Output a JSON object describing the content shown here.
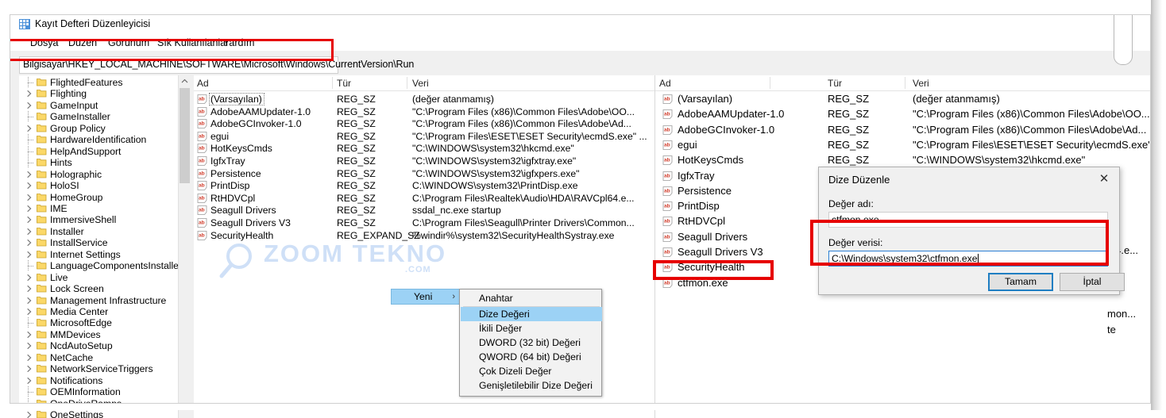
{
  "window": {
    "title": "Kayıt Defteri Düzenleyicisi",
    "icon": "registry-editor-icon",
    "menu": [
      "Dosya",
      "Düzen",
      "Görünüm",
      "Sık Kullanılanlar",
      "Yardım"
    ],
    "address_value": "Bilgisayar\\HKEY_LOCAL_MACHINE\\SOFTWARE\\Microsoft\\Windows\\CurrentVersion\\Run"
  },
  "tree": {
    "items": [
      {
        "label": "FlightedFeatures",
        "expandable": false
      },
      {
        "label": "Flighting",
        "expandable": true
      },
      {
        "label": "GameInput",
        "expandable": true
      },
      {
        "label": "GameInstaller",
        "expandable": false
      },
      {
        "label": "Group Policy",
        "expandable": true
      },
      {
        "label": "HardwareIdentification",
        "expandable": false
      },
      {
        "label": "HelpAndSupport",
        "expandable": false
      },
      {
        "label": "Hints",
        "expandable": false
      },
      {
        "label": "Holographic",
        "expandable": true
      },
      {
        "label": "HoloSI",
        "expandable": true
      },
      {
        "label": "HomeGroup",
        "expandable": true
      },
      {
        "label": "IME",
        "expandable": true
      },
      {
        "label": "ImmersiveShell",
        "expandable": true
      },
      {
        "label": "Installer",
        "expandable": true
      },
      {
        "label": "InstallService",
        "expandable": true
      },
      {
        "label": "Internet Settings",
        "expandable": true
      },
      {
        "label": "LanguageComponentsInstaller",
        "expandable": false
      },
      {
        "label": "Live",
        "expandable": true
      },
      {
        "label": "Lock Screen",
        "expandable": true
      },
      {
        "label": "Management Infrastructure",
        "expandable": true
      },
      {
        "label": "Media Center",
        "expandable": true
      },
      {
        "label": "MicrosoftEdge",
        "expandable": false
      },
      {
        "label": "MMDevices",
        "expandable": true
      },
      {
        "label": "NcdAutoSetup",
        "expandable": true
      },
      {
        "label": "NetCache",
        "expandable": true
      },
      {
        "label": "NetworkServiceTriggers",
        "expandable": true
      },
      {
        "label": "Notifications",
        "expandable": true
      },
      {
        "label": "OEMInformation",
        "expandable": false
      },
      {
        "label": "OneDriveRamps",
        "expandable": false
      },
      {
        "label": "OneSettings",
        "expandable": true
      }
    ]
  },
  "list": {
    "columns": [
      "Ad",
      "Tür",
      "Veri"
    ],
    "rows": [
      {
        "name": "(Varsayılan)",
        "type": "REG_SZ",
        "data": "(değer atanmamış)"
      },
      {
        "name": "AdobeAAMUpdater-1.0",
        "type": "REG_SZ",
        "data": "\"C:\\Program Files (x86)\\Common Files\\Adobe\\OO..."
      },
      {
        "name": "AdobeGCInvoker-1.0",
        "type": "REG_SZ",
        "data": "\"C:\\Program Files (x86)\\Common Files\\Adobe\\Ad..."
      },
      {
        "name": "egui",
        "type": "REG_SZ",
        "data": "\"C:\\Program Files\\ESET\\ESET Security\\ecmdS.exe\" ..."
      },
      {
        "name": "HotKeysCmds",
        "type": "REG_SZ",
        "data": "\"C:\\WINDOWS\\system32\\hkcmd.exe\""
      },
      {
        "name": "IgfxTray",
        "type": "REG_SZ",
        "data": "\"C:\\WINDOWS\\system32\\igfxtray.exe\""
      },
      {
        "name": "Persistence",
        "type": "REG_SZ",
        "data": "\"C:\\WINDOWS\\system32\\igfxpers.exe\""
      },
      {
        "name": "PrintDisp",
        "type": "REG_SZ",
        "data": "C:\\WINDOWS\\system32\\PrintDisp.exe"
      },
      {
        "name": "RtHDVCpl",
        "type": "REG_SZ",
        "data": "C:\\Program Files\\Realtek\\Audio\\HDA\\RAVCpl64.e..."
      },
      {
        "name": "Seagull Drivers",
        "type": "REG_SZ",
        "data": "ssdal_nc.exe startup"
      },
      {
        "name": "Seagull Drivers V3",
        "type": "REG_SZ",
        "data": "C:\\Program Files\\Seagull\\Printer Drivers\\Common..."
      },
      {
        "name": "SecurityHealth",
        "type": "REG_EXPAND_SZ",
        "data": "%windir%\\system32\\SecurityHealthSystray.exe"
      }
    ]
  },
  "right_pane": {
    "columns": [
      "Ad",
      "Tür",
      "Veri"
    ],
    "names": [
      "(Varsayılan)",
      "AdobeAAMUpdater-1.0",
      "AdobeGCInvoker-1.0",
      "egui",
      "HotKeysCmds",
      "IgfxTray",
      "Persistence",
      "PrintDisp",
      "RtHDVCpl",
      "Seagull Drivers",
      "Seagull Drivers V3",
      "SecurityHealth",
      "ctfmon.exe"
    ],
    "types": [
      "REG_SZ",
      "REG_SZ",
      "REG_SZ",
      "REG_SZ",
      "REG_SZ"
    ],
    "datas": [
      "(değer atanmamış)",
      "\"C:\\Program Files (x86)\\Common Files\\Adobe\\OO...",
      "\"C:\\Program Files (x86)\\Common Files\\Adobe\\Ad...",
      "\"C:\\Program Files\\ESET\\ESET Security\\ecmdS.exe\" ...",
      "\"C:\\WINDOWS\\system32\\hkcmd.exe\""
    ],
    "clipped_tails": [
      "l64.e...",
      "mon...",
      "te"
    ]
  },
  "context_menu": {
    "parent_label": "Yeni",
    "parent_arrow": "›",
    "items": [
      {
        "label": "Anahtar",
        "selected": false
      },
      {
        "label": "Dize Değeri",
        "selected": true
      },
      {
        "label": "İkili Değer",
        "selected": false
      },
      {
        "label": "DWORD (32 bit) Değeri",
        "selected": false
      },
      {
        "label": "QWORD (64 bit) Değeri",
        "selected": false
      },
      {
        "label": "Çok Dizeli Değer",
        "selected": false
      },
      {
        "label": "Genişletilebilir Dize Değeri",
        "selected": false
      }
    ]
  },
  "dialog": {
    "title": "Dize Düzenle",
    "close_icon": "✕",
    "name_label": "Değer adı:",
    "name_value": "ctfmon.exe",
    "data_label": "Değer verisi:",
    "data_value": "C:\\Windows\\system32\\ctfmon.exe",
    "ok_label": "Tamam",
    "cancel_label": "İptal"
  },
  "watermark": {
    "text": "ZOOM TEKNO",
    "suffix": ".COM"
  },
  "colors": {
    "highlight": "#9cd2f5",
    "annotation_red": "#e60000",
    "folder_yellow": "#fbd868",
    "reg_icon_red": "#d13b2a",
    "watermark_blue": "#cfe0f7",
    "primary_button_border": "#1f7ec2"
  }
}
